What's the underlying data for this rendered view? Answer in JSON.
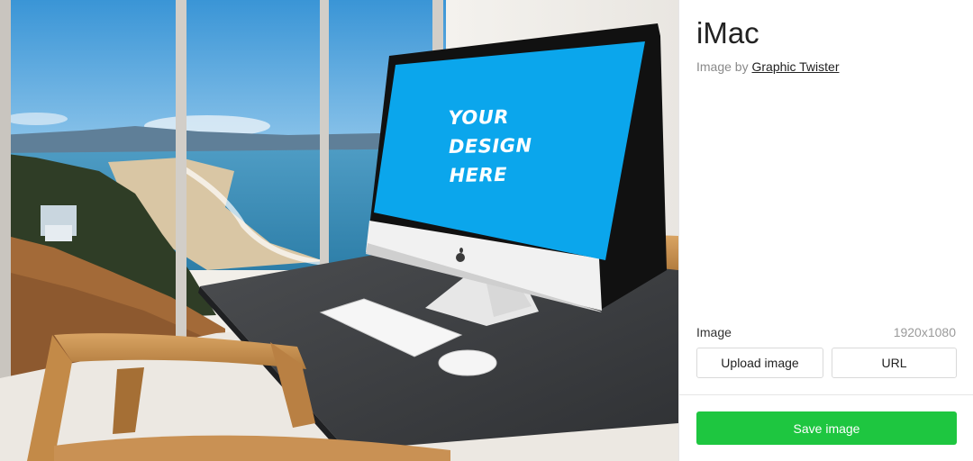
{
  "preview": {
    "screen_lines": [
      "YOUR",
      "DESIGN",
      "HERE"
    ],
    "screen_color": "#0ba6ec"
  },
  "panel": {
    "title": "iMac",
    "credit_prefix": "Image by",
    "credit_author": "Graphic Twister",
    "image_label": "Image",
    "image_size": "1920x1080",
    "upload_label": "Upload image",
    "url_label": "URL",
    "save_label": "Save image",
    "save_color": "#1ec640"
  }
}
